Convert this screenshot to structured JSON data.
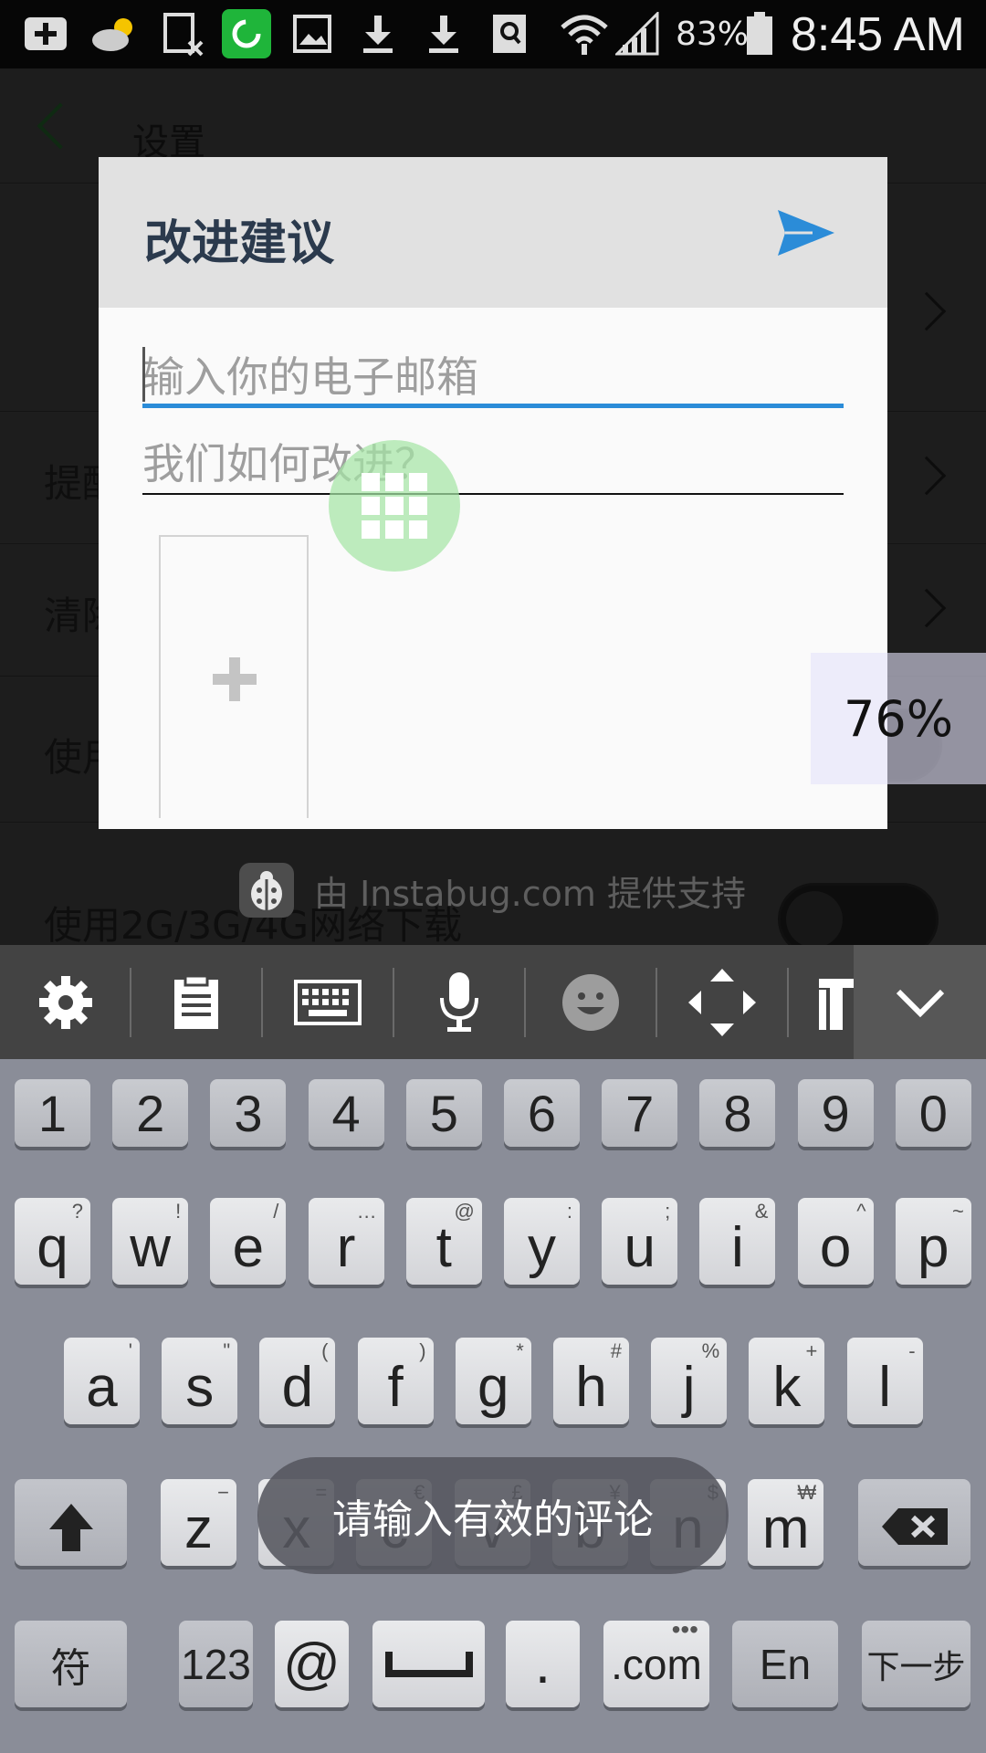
{
  "status_bar": {
    "battery_percent": "83%",
    "time": "8:45 AM",
    "icons": [
      "add-icon",
      "weather-icon",
      "sim-error-icon",
      "sync-app-icon",
      "gallery-icon",
      "download-icon",
      "download-icon",
      "search-app-icon",
      "wifi-icon",
      "signal-icon",
      "battery-icon"
    ]
  },
  "background_page": {
    "title": "设置",
    "rows": [
      {
        "label": "提醒"
      },
      {
        "label": "清除"
      },
      {
        "label": "使用"
      }
    ],
    "network_label": "使用2G/3G/4G网络下载"
  },
  "dialog": {
    "title": "改进建议",
    "email_placeholder": "输入你的电子邮箱",
    "comment_placeholder": "我们如何改进？",
    "send_color": "#2b8cd8"
  },
  "powered_by": "由 Instabug.com 提供支持",
  "overlay_percent": "76%",
  "toast": "请输入有效的评论",
  "keyboard_toolbar": [
    "settings-icon",
    "clipboard-icon",
    "keyboard-icon",
    "microphone-icon",
    "emoji-icon",
    "move-icon",
    "text-format-icon",
    "collapse-icon"
  ],
  "keyboard": {
    "numbers": [
      "1",
      "2",
      "3",
      "4",
      "5",
      "6",
      "7",
      "8",
      "9",
      "0"
    ],
    "row1": [
      {
        "k": "q",
        "s": "?"
      },
      {
        "k": "w",
        "s": "!"
      },
      {
        "k": "e",
        "s": "/"
      },
      {
        "k": "r",
        "s": "…"
      },
      {
        "k": "t",
        "s": "@"
      },
      {
        "k": "y",
        "s": ":"
      },
      {
        "k": "u",
        "s": ";"
      },
      {
        "k": "i",
        "s": "&"
      },
      {
        "k": "o",
        "s": "^"
      },
      {
        "k": "p",
        "s": "~"
      }
    ],
    "row2": [
      {
        "k": "a",
        "s": "'"
      },
      {
        "k": "s",
        "s": "\""
      },
      {
        "k": "d",
        "s": "("
      },
      {
        "k": "f",
        "s": ")"
      },
      {
        "k": "g",
        "s": "*"
      },
      {
        "k": "h",
        "s": "#"
      },
      {
        "k": "j",
        "s": "%"
      },
      {
        "k": "k",
        "s": "+"
      },
      {
        "k": "l",
        "s": "-"
      }
    ],
    "row3": [
      {
        "k": "z",
        "s": "−"
      },
      {
        "k": "x",
        "s": "="
      },
      {
        "k": "c",
        "s": "€"
      },
      {
        "k": "v",
        "s": "£"
      },
      {
        "k": "b",
        "s": "¥"
      },
      {
        "k": "n",
        "s": "$"
      },
      {
        "k": "m",
        "s": "₩"
      }
    ],
    "bottom": {
      "symbols": "符",
      "numbers": "123",
      "at": "@",
      "period": ".",
      "dotcom": ".com",
      "lang": "En",
      "next": "下一步"
    }
  }
}
